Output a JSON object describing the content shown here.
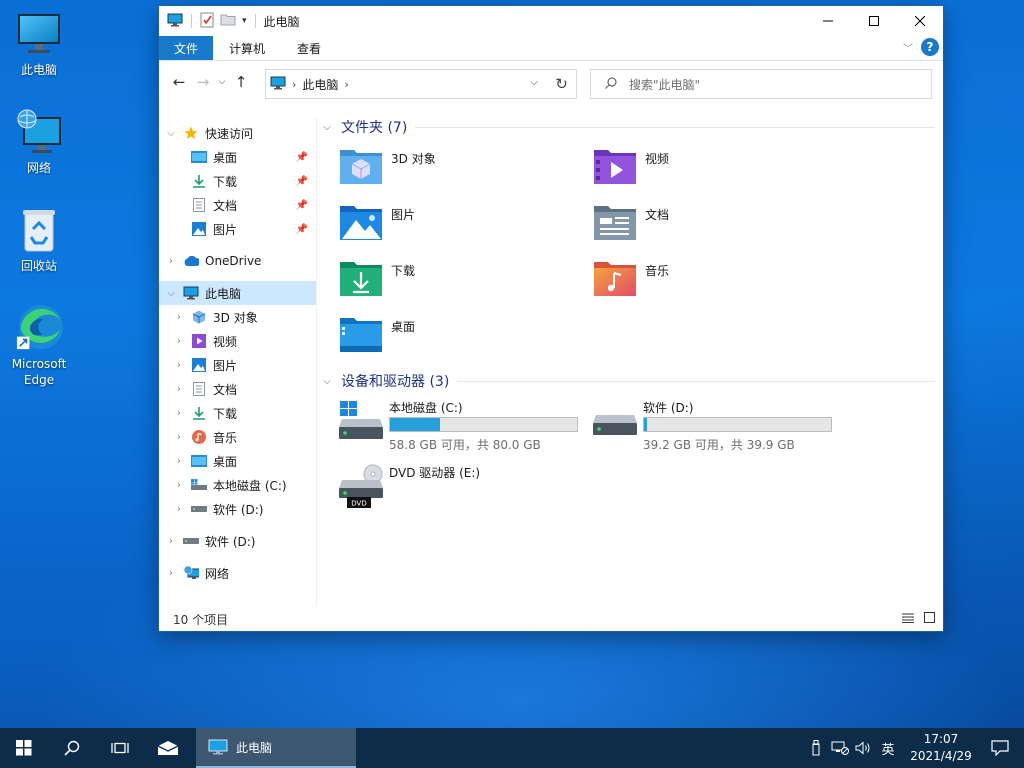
{
  "desktop": {
    "icons": [
      {
        "label": "此电脑"
      },
      {
        "label": "网络"
      },
      {
        "label": "回收站"
      },
      {
        "label": "Microsoft Edge"
      }
    ]
  },
  "window": {
    "title": "此电脑",
    "ribbon_tabs": [
      "文件",
      "计算机",
      "查看"
    ],
    "address_crumb": "此电脑",
    "search_placeholder": "搜索\"此电脑\"",
    "nav": {
      "quick_access": "快速访问",
      "quick_items": [
        "桌面",
        "下载",
        "文档",
        "图片"
      ],
      "onedrive": "OneDrive",
      "this_pc": "此电脑",
      "pc_items": [
        "3D 对象",
        "视频",
        "图片",
        "文档",
        "下载",
        "音乐",
        "桌面",
        "本地磁盘 (C:)",
        "软件 (D:)"
      ],
      "drive_d": "软件 (D:)",
      "network": "网络"
    },
    "folders_header": "文件夹 (7)",
    "folders": [
      "3D 对象",
      "视频",
      "图片",
      "文档",
      "下载",
      "音乐",
      "桌面"
    ],
    "devices_header": "设备和驱动器 (3)",
    "drives": [
      {
        "name": "本地磁盘 (C:)",
        "detail": "58.8 GB 可用，共 80.0 GB",
        "used_fraction": 0.265
      },
      {
        "name": "软件 (D:)",
        "detail": "39.2 GB 可用，共 39.9 GB",
        "used_fraction": 0.018
      },
      {
        "name": "DVD 驱动器 (E:)",
        "badge": "DVD"
      }
    ],
    "status": "10 个项目"
  },
  "taskbar": {
    "app_label": "此电脑",
    "ime": "英",
    "time": "17:07",
    "date": "2021/4/29"
  },
  "colors": {
    "accent": "#1979ca",
    "progress": "#26a0da",
    "taskbar": "#0d2c49"
  }
}
